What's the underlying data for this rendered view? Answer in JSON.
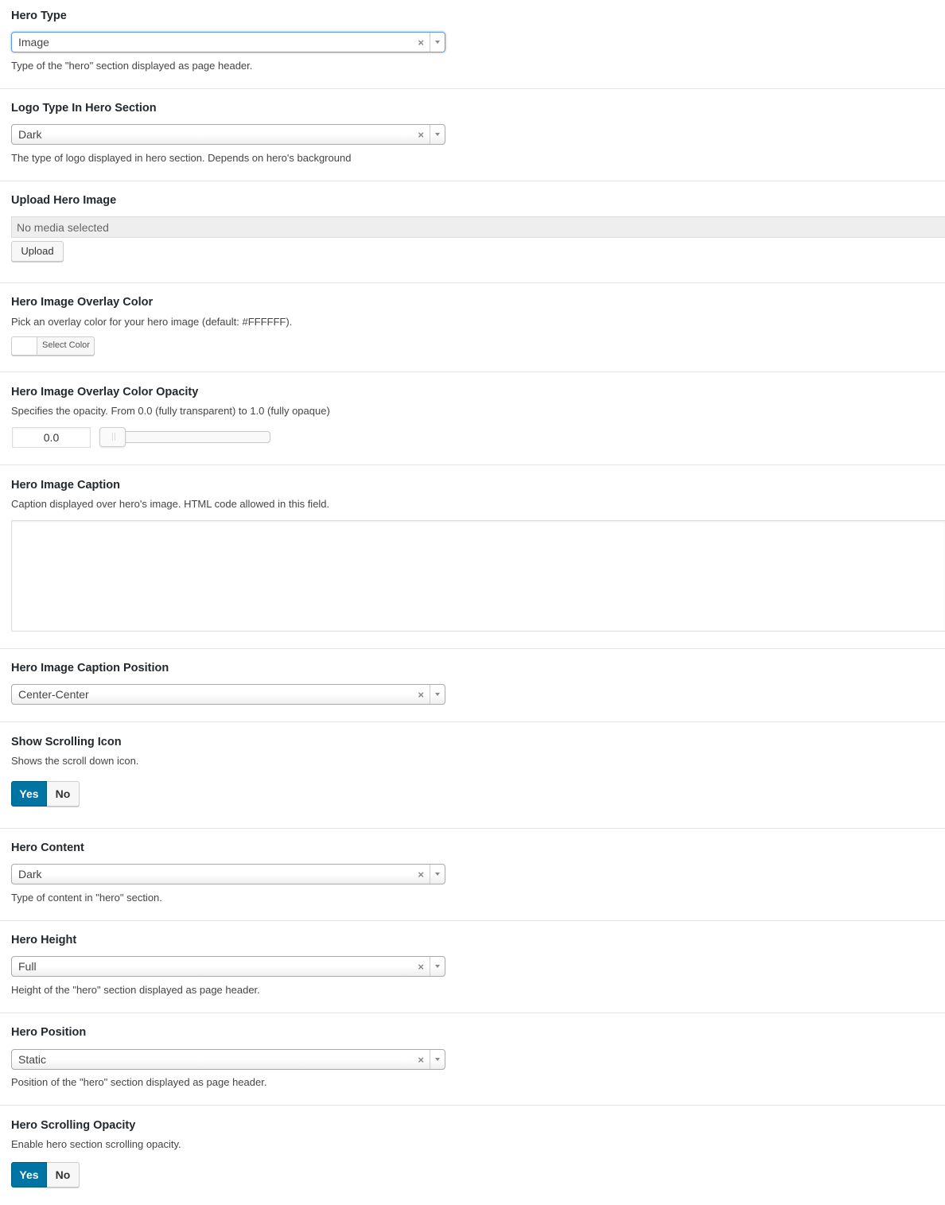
{
  "fields": {
    "hero_type": {
      "title": "Hero Type",
      "value": "Image",
      "clear": "×",
      "description": "Type of the \"hero\" section displayed as page header."
    },
    "logo_type": {
      "title": "Logo Type In Hero Section",
      "value": "Dark",
      "clear": "×",
      "description": "The type of logo displayed in hero section. Depends on hero's background"
    },
    "upload_image": {
      "title": "Upload Hero Image",
      "placeholder": "No media selected",
      "button": "Upload"
    },
    "overlay_color": {
      "title": "Hero Image Overlay Color",
      "description": "Pick an overlay color for your hero image (default: #FFFFFF).",
      "button": "Select Color",
      "swatch_color": "#FFFFFF"
    },
    "overlay_opacity": {
      "title": "Hero Image Overlay Color Opacity",
      "description": "Specifies the opacity. From 0.0 (fully transparent) to 1.0 (fully opaque)",
      "value": "0.0",
      "slider_level": 0.0
    },
    "caption": {
      "title": "Hero Image Caption",
      "description": "Caption displayed over hero's image. HTML code allowed in this field.",
      "value": ""
    },
    "caption_position": {
      "title": "Hero Image Caption Position",
      "value": "Center-Center",
      "clear": "×"
    },
    "scrolling_icon": {
      "title": "Show Scrolling Icon",
      "description": "Shows the scroll down icon.",
      "yes": "Yes",
      "no": "No",
      "selected": "Yes"
    },
    "hero_content": {
      "title": "Hero Content",
      "value": "Dark",
      "clear": "×",
      "description": "Type of content in \"hero\" section."
    },
    "hero_height": {
      "title": "Hero Height",
      "value": "Full",
      "clear": "×",
      "description": "Height of the \"hero\" section displayed as page header."
    },
    "hero_position": {
      "title": "Hero Position",
      "value": "Static",
      "clear": "×",
      "description": "Position of the \"hero\" section displayed as page header."
    },
    "scrolling_opacity": {
      "title": "Hero Scrolling Opacity",
      "description": "Enable hero section scrolling opacity.",
      "yes": "Yes",
      "no": "No",
      "selected": "Yes"
    }
  },
  "colors": {
    "toggle_active": "#0074A2",
    "focus_border": "#5897FB"
  },
  "icons": {
    "select_arrow": "chevron-down-icon",
    "clear": "close-icon"
  }
}
